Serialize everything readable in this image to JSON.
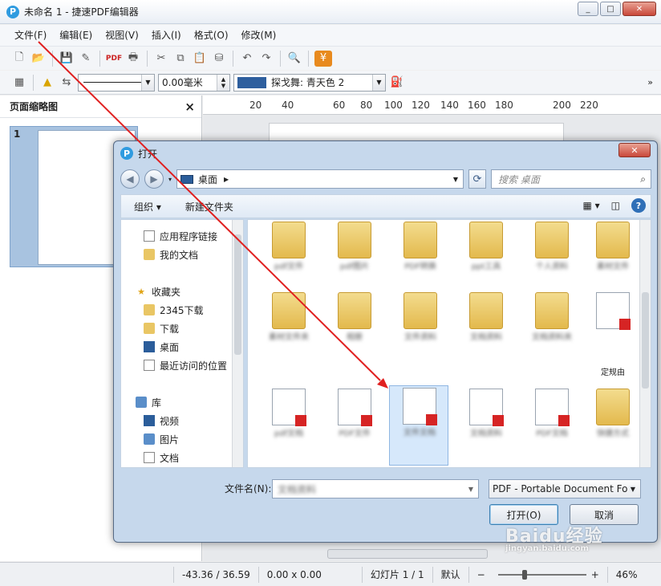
{
  "window": {
    "title": "未命名 1 - 捷速PDF编辑器",
    "min": "_",
    "max": "□",
    "close": "✕"
  },
  "menu": [
    "文件(F)",
    "编辑(E)",
    "视图(V)",
    "插入(I)",
    "格式(O)",
    "修改(M)"
  ],
  "format_bar": {
    "line_width": "0.00毫米",
    "fill_color_name": "探戈舞: 青天色 2",
    "fill_color": "#2e5f9e"
  },
  "left_panel": {
    "title": "页面缩略图",
    "close": "×",
    "page_number": "1"
  },
  "ruler": [
    "20",
    "40",
    "60",
    "80",
    "100",
    "120",
    "140",
    "160",
    "180",
    "200",
    "220"
  ],
  "dialog": {
    "title": "打开",
    "close": "✕",
    "address": "桌面",
    "search_placeholder": "搜索 桌面",
    "organize": "组织 ▾",
    "new_folder": "新建文件夹",
    "nav": [
      {
        "label": "应用程序链接",
        "icon": "page-icon"
      },
      {
        "label": "我的文档",
        "icon": "folder-icon"
      },
      {
        "label": "收藏夹",
        "icon": "star-icon"
      },
      {
        "label": "2345下载",
        "icon": "folder-icon"
      },
      {
        "label": "下载",
        "icon": "folder-icon"
      },
      {
        "label": "桌面",
        "icon": "desktop-icon"
      },
      {
        "label": "最近访问的位置",
        "icon": "recent-icon"
      },
      {
        "label": "库",
        "icon": "library-icon"
      },
      {
        "label": "视频",
        "icon": "video-icon"
      },
      {
        "label": "图片",
        "icon": "picture-icon"
      },
      {
        "label": "文档",
        "icon": "document-icon"
      }
    ],
    "files": [
      {
        "label": "pdf文件",
        "type": "folder"
      },
      {
        "label": "pdf图片",
        "type": "folder"
      },
      {
        "label": "PDF转换",
        "type": "folder"
      },
      {
        "label": "ppt工具",
        "type": "folder"
      },
      {
        "label": "个人资料",
        "type": "folder"
      },
      {
        "label": "素材文件",
        "type": "folder"
      },
      {
        "label": "素材文件夹",
        "type": "folder"
      },
      {
        "label": "相册",
        "type": "folder"
      },
      {
        "label": "文件资料",
        "type": "folder"
      },
      {
        "label": "文档资料",
        "type": "folder"
      },
      {
        "label": "文档资料夹",
        "type": "folder"
      },
      {
        "label": "定规由",
        "type": "pdf"
      },
      {
        "label": "pdf文档",
        "type": "pdf"
      },
      {
        "label": "PDF文件",
        "type": "pdf"
      },
      {
        "label": "文件文档",
        "type": "pdf"
      },
      {
        "label": "文档资料",
        "type": "pdf"
      },
      {
        "label": "PDF文档",
        "type": "pdf"
      },
      {
        "label": "快捷方式",
        "type": "shortcut"
      }
    ],
    "filename_label": "文件名(N):",
    "filename_value": "文档资料",
    "filetype": "PDF - Portable Document Fo",
    "open_btn": "打开(O)",
    "cancel_btn": "取消"
  },
  "status": {
    "coords": "-43.36 / 36.59",
    "size": "0.00 x 0.00",
    "slide": "幻灯片 1 / 1",
    "mode": "默认",
    "zoom": "46%",
    "zoom_fraction": 0.46
  },
  "watermark": "Baidu经验",
  "watermark_url": "jingyan.baidu.com"
}
